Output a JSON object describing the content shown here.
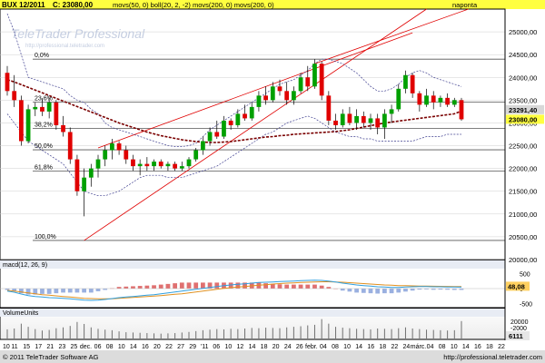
{
  "header": {
    "symbol": "BUX 12/2011",
    "close_label": "C: 23080,00",
    "indicators_label": "movs(50, 0)  boll(20, 2, -2)  movs(200, 0)  movs(200, 0)",
    "period": "naponta"
  },
  "watermark": {
    "brand": "TeleTrader Professional",
    "url": "http://professional.teletrader.com"
  },
  "main_axis": {
    "ticks": [
      "25000,00",
      "24500,00",
      "24000,00",
      "23500,00",
      "23000,00",
      "22500,00",
      "22000,00",
      "21500,00",
      "21000,00",
      "20500,00",
      "20000,00"
    ],
    "last_price": "23291,40",
    "close_price": "23080,00"
  },
  "fib_labels": [
    "0,0%",
    "23,6%",
    "38,2%",
    "50,0%",
    "61,8%",
    "100,0%"
  ],
  "macd": {
    "label": "macd(12, 26, 9)",
    "value": "48,08",
    "ticks": [
      "500",
      "0",
      "-500"
    ]
  },
  "volume": {
    "label": "VolumeUnits",
    "value": "6111",
    "ticks": [
      "20000",
      "-2000"
    ]
  },
  "x_axis": {
    "labels": [
      "10",
      "11",
      "15",
      "17",
      "21",
      "23",
      "25",
      "dec.",
      "06",
      "08",
      "10",
      "14",
      "16",
      "20",
      "22",
      "27",
      "29",
      "'11",
      "06",
      "10",
      "12",
      "14",
      "18",
      "20",
      "24",
      "26",
      "febr.",
      "04",
      "08",
      "10",
      "14",
      "16",
      "18",
      "22",
      "24",
      "márc.",
      "04",
      "08",
      "10",
      "14",
      "16",
      "18",
      "22"
    ]
  },
  "footer": {
    "copyright": "© 2011 TeleTrader Software AG",
    "url": "http://professional.teletrader.com"
  },
  "colors": {
    "up": "#00a000",
    "down": "#e00000",
    "grid": "#888888",
    "ma": "#7a0000",
    "bollinger": "#404090",
    "trend": "#e00000",
    "header_bg": "#ffff40"
  },
  "chart_data": {
    "type": "candlestick",
    "title": "BUX 12/2011",
    "ylim": [
      20000,
      25500
    ],
    "candles": [
      {
        "o": 24100,
        "h": 24250,
        "l": 23600,
        "c": 23700
      },
      {
        "o": 23700,
        "h": 24050,
        "l": 23350,
        "c": 23500
      },
      {
        "o": 23500,
        "h": 23600,
        "l": 22500,
        "c": 22600
      },
      {
        "o": 22600,
        "h": 23400,
        "l": 22550,
        "c": 23300
      },
      {
        "o": 23300,
        "h": 23450,
        "l": 23150,
        "c": 23350
      },
      {
        "o": 23350,
        "h": 23550,
        "l": 23150,
        "c": 23250
      },
      {
        "o": 23250,
        "h": 23550,
        "l": 23100,
        "c": 23450
      },
      {
        "o": 23450,
        "h": 23500,
        "l": 22850,
        "c": 22950
      },
      {
        "o": 22950,
        "h": 23150,
        "l": 22700,
        "c": 22800
      },
      {
        "o": 22800,
        "h": 22900,
        "l": 22100,
        "c": 22200
      },
      {
        "o": 22200,
        "h": 22300,
        "l": 21400,
        "c": 21500
      },
      {
        "o": 21500,
        "h": 22000,
        "l": 20950,
        "c": 21800
      },
      {
        "o": 21800,
        "h": 22100,
        "l": 21600,
        "c": 22000
      },
      {
        "o": 22000,
        "h": 22300,
        "l": 21800,
        "c": 22200
      },
      {
        "o": 22200,
        "h": 22500,
        "l": 22050,
        "c": 22400
      },
      {
        "o": 22400,
        "h": 22650,
        "l": 22200,
        "c": 22550
      },
      {
        "o": 22550,
        "h": 22600,
        "l": 22300,
        "c": 22400
      },
      {
        "o": 22400,
        "h": 22500,
        "l": 22100,
        "c": 22200
      },
      {
        "o": 22200,
        "h": 22300,
        "l": 21950,
        "c": 22050
      },
      {
        "o": 22050,
        "h": 22200,
        "l": 21850,
        "c": 22100
      },
      {
        "o": 22100,
        "h": 22250,
        "l": 21950,
        "c": 22050
      },
      {
        "o": 22050,
        "h": 22200,
        "l": 21950,
        "c": 22150
      },
      {
        "o": 22150,
        "h": 22200,
        "l": 22000,
        "c": 22050
      },
      {
        "o": 22050,
        "h": 22150,
        "l": 21950,
        "c": 22100
      },
      {
        "o": 22100,
        "h": 22150,
        "l": 21950,
        "c": 22000
      },
      {
        "o": 22000,
        "h": 22150,
        "l": 21950,
        "c": 22050
      },
      {
        "o": 22050,
        "h": 22250,
        "l": 22000,
        "c": 22200
      },
      {
        "o": 22200,
        "h": 22450,
        "l": 22150,
        "c": 22400
      },
      {
        "o": 22400,
        "h": 22700,
        "l": 22300,
        "c": 22600
      },
      {
        "o": 22600,
        "h": 22900,
        "l": 22500,
        "c": 22800
      },
      {
        "o": 22800,
        "h": 23050,
        "l": 22650,
        "c": 22700
      },
      {
        "o": 22700,
        "h": 23150,
        "l": 22650,
        "c": 23050
      },
      {
        "o": 23050,
        "h": 23100,
        "l": 22850,
        "c": 22950
      },
      {
        "o": 22950,
        "h": 23300,
        "l": 22900,
        "c": 23200
      },
      {
        "o": 23200,
        "h": 23400,
        "l": 23050,
        "c": 23100
      },
      {
        "o": 23100,
        "h": 23450,
        "l": 23050,
        "c": 23350
      },
      {
        "o": 23350,
        "h": 23700,
        "l": 23250,
        "c": 23600
      },
      {
        "o": 23600,
        "h": 23800,
        "l": 23400,
        "c": 23500
      },
      {
        "o": 23500,
        "h": 23900,
        "l": 23450,
        "c": 23800
      },
      {
        "o": 23800,
        "h": 23950,
        "l": 23600,
        "c": 23700
      },
      {
        "o": 23700,
        "h": 23900,
        "l": 23400,
        "c": 23500
      },
      {
        "o": 23500,
        "h": 23800,
        "l": 23400,
        "c": 23700
      },
      {
        "o": 23700,
        "h": 24100,
        "l": 23650,
        "c": 24000
      },
      {
        "o": 24000,
        "h": 24250,
        "l": 23700,
        "c": 23800
      },
      {
        "o": 23800,
        "h": 24400,
        "l": 23750,
        "c": 24300
      },
      {
        "o": 24300,
        "h": 24350,
        "l": 23500,
        "c": 23600
      },
      {
        "o": 23600,
        "h": 23700,
        "l": 22950,
        "c": 23050
      },
      {
        "o": 23050,
        "h": 23200,
        "l": 22850,
        "c": 22950
      },
      {
        "o": 22950,
        "h": 23300,
        "l": 22900,
        "c": 23200
      },
      {
        "o": 23200,
        "h": 23350,
        "l": 22950,
        "c": 23000
      },
      {
        "o": 23000,
        "h": 23300,
        "l": 22850,
        "c": 23150
      },
      {
        "o": 23150,
        "h": 23250,
        "l": 22900,
        "c": 23000
      },
      {
        "o": 23000,
        "h": 23200,
        "l": 22850,
        "c": 23100
      },
      {
        "o": 23100,
        "h": 23200,
        "l": 22750,
        "c": 22900
      },
      {
        "o": 22900,
        "h": 23300,
        "l": 22650,
        "c": 23200
      },
      {
        "o": 23200,
        "h": 23400,
        "l": 23000,
        "c": 23300
      },
      {
        "o": 23300,
        "h": 23850,
        "l": 23250,
        "c": 23750
      },
      {
        "o": 23750,
        "h": 24150,
        "l": 23650,
        "c": 24050
      },
      {
        "o": 24050,
        "h": 24100,
        "l": 23550,
        "c": 23650
      },
      {
        "o": 23650,
        "h": 23700,
        "l": 23250,
        "c": 23400
      },
      {
        "o": 23400,
        "h": 23750,
        "l": 23350,
        "c": 23600
      },
      {
        "o": 23600,
        "h": 23700,
        "l": 23300,
        "c": 23450
      },
      {
        "o": 23450,
        "h": 23600,
        "l": 23350,
        "c": 23550
      },
      {
        "o": 23550,
        "h": 23650,
        "l": 23350,
        "c": 23400
      },
      {
        "o": 23400,
        "h": 23550,
        "l": 23350,
        "c": 23500
      },
      {
        "o": 23500,
        "h": 23550,
        "l": 23050,
        "c": 23080
      }
    ],
    "ma50": [
      23950,
      23900,
      23840,
      23780,
      23720,
      23660,
      23600,
      23540,
      23480,
      23420,
      23360,
      23300,
      23240,
      23180,
      23120,
      23060,
      23000,
      22950,
      22900,
      22850,
      22800,
      22760,
      22720,
      22690,
      22660,
      22630,
      22610,
      22590,
      22580,
      22570,
      22570,
      22580,
      22590,
      22610,
      22630,
      22650,
      22670,
      22690,
      22700,
      22720,
      22730,
      22750,
      22760,
      22770,
      22780,
      22790,
      22800,
      22810,
      22830,
      22850,
      22880,
      22910,
      22940,
      22970,
      23000,
      23020,
      23040,
      23060,
      23080,
      23100,
      23120,
      23140,
      23160,
      23180,
      23200,
      23260
    ],
    "boll_upper": [
      25400,
      25000,
      24500,
      24000,
      23950,
      23900,
      23850,
      23800,
      23750,
      23600,
      23500,
      23450,
      23300,
      23200,
      23000,
      22900,
      22850,
      22800,
      22750,
      22700,
      22650,
      22600,
      22550,
      22500,
      22480,
      22480,
      22500,
      22550,
      22700,
      22850,
      22950,
      23050,
      23150,
      23250,
      23350,
      23450,
      23550,
      23650,
      23750,
      23850,
      23900,
      23950,
      24050,
      24150,
      24300,
      24400,
      24400,
      24350,
      24300,
      24200,
      24100,
      23950,
      23800,
      23700,
      23700,
      23750,
      23850,
      24000,
      24100,
      24150,
      24100,
      24000,
      23950,
      23900,
      23850,
      23800
    ],
    "boll_lower": [
      23200,
      23000,
      22800,
      22600,
      22500,
      22400,
      22300,
      22200,
      22100,
      21900,
      21700,
      21500,
      21450,
      21400,
      21400,
      21450,
      21500,
      21600,
      21700,
      21800,
      21850,
      21850,
      21850,
      21800,
      21800,
      21800,
      21850,
      21900,
      21950,
      22000,
      22050,
      22150,
      22250,
      22350,
      22450,
      22550,
      22650,
      22750,
      22800,
      22900,
      23000,
      23050,
      23100,
      23150,
      23100,
      23000,
      22900,
      22800,
      22750,
      22700,
      22700,
      22650,
      22650,
      22600,
      22600,
      22600,
      22600,
      22600,
      22600,
      22650,
      22700,
      22700,
      22700,
      22750,
      22750,
      22750
    ],
    "fib_levels": [
      24400,
      23460,
      22880,
      22410,
      21940,
      20420
    ],
    "macd_line": [
      -80,
      -120,
      -180,
      -230,
      -260,
      -280,
      -300,
      -310,
      -320,
      -340,
      -360,
      -380,
      -390,
      -380,
      -360,
      -330,
      -300,
      -280,
      -260,
      -240,
      -220,
      -200,
      -170,
      -140,
      -110,
      -80,
      -50,
      -20,
      10,
      40,
      70,
      100,
      120,
      140,
      160,
      180,
      200,
      210,
      220,
      230,
      240,
      250,
      260,
      270,
      280,
      270,
      250,
      220,
      180,
      150,
      120,
      100,
      80,
      60,
      50,
      40,
      40,
      50,
      60,
      70,
      70,
      60,
      60,
      55,
      50,
      48
    ],
    "signal_line": [
      -60,
      -80,
      -110,
      -140,
      -170,
      -200,
      -220,
      -240,
      -260,
      -280,
      -300,
      -320,
      -330,
      -340,
      -340,
      -335,
      -325,
      -310,
      -295,
      -280,
      -265,
      -250,
      -230,
      -210,
      -190,
      -170,
      -140,
      -110,
      -80,
      -50,
      -20,
      10,
      30,
      50,
      70,
      90,
      110,
      130,
      150,
      165,
      180,
      190,
      200,
      210,
      220,
      225,
      225,
      220,
      210,
      195,
      180,
      165,
      150,
      135,
      120,
      110,
      100,
      95,
      90,
      85,
      82,
      78,
      75,
      72,
      70,
      68
    ],
    "volume": [
      3200,
      3500,
      5200,
      4100,
      3300,
      2800,
      3000,
      3600,
      3900,
      4400,
      5800,
      5100,
      3900,
      3400,
      3100,
      2900,
      2500,
      2200,
      2100,
      2000,
      1900,
      1800,
      1700,
      1800,
      1900,
      2100,
      2300,
      2600,
      2900,
      3100,
      3300,
      3200,
      3400,
      3300,
      3500,
      3700,
      3600,
      3800,
      3700,
      3600,
      3900,
      4100,
      4300,
      4600,
      4800,
      6800,
      5200,
      4100,
      3800,
      3600,
      3400,
      3300,
      3200,
      3500,
      3400,
      3300,
      3600,
      3900,
      3500,
      3300,
      3100,
      3000,
      2900,
      2800,
      2900,
      6111
    ]
  }
}
